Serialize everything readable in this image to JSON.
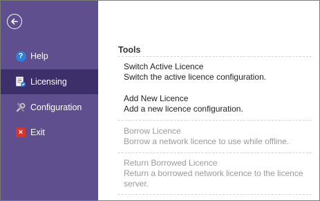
{
  "sidebar": {
    "items": [
      {
        "label": "Help",
        "icon": "help-icon",
        "active": false
      },
      {
        "label": "Licensing",
        "icon": "licence-icon",
        "active": true
      },
      {
        "label": "Configuration",
        "icon": "tools-icon",
        "active": false
      },
      {
        "label": "Exit",
        "icon": "exit-icon",
        "active": false
      }
    ],
    "colors": {
      "background": "#5f4f8f",
      "active": "#3c2f6a"
    }
  },
  "main": {
    "section_title": "Tools",
    "tools": [
      {
        "title": "Switch Active Licence",
        "description": "Switch the active licence configuration.",
        "enabled": true
      },
      {
        "title": "Add New Licence",
        "description": "Add a new licence configuration.",
        "enabled": true
      },
      {
        "title": "Borrow Licence",
        "description": "Borrow a network licence to use while offline.",
        "enabled": false
      },
      {
        "title": "Return Borrowed Licence",
        "description": "Return a borrowed network licence to the licence server.",
        "enabled": false
      }
    ]
  }
}
